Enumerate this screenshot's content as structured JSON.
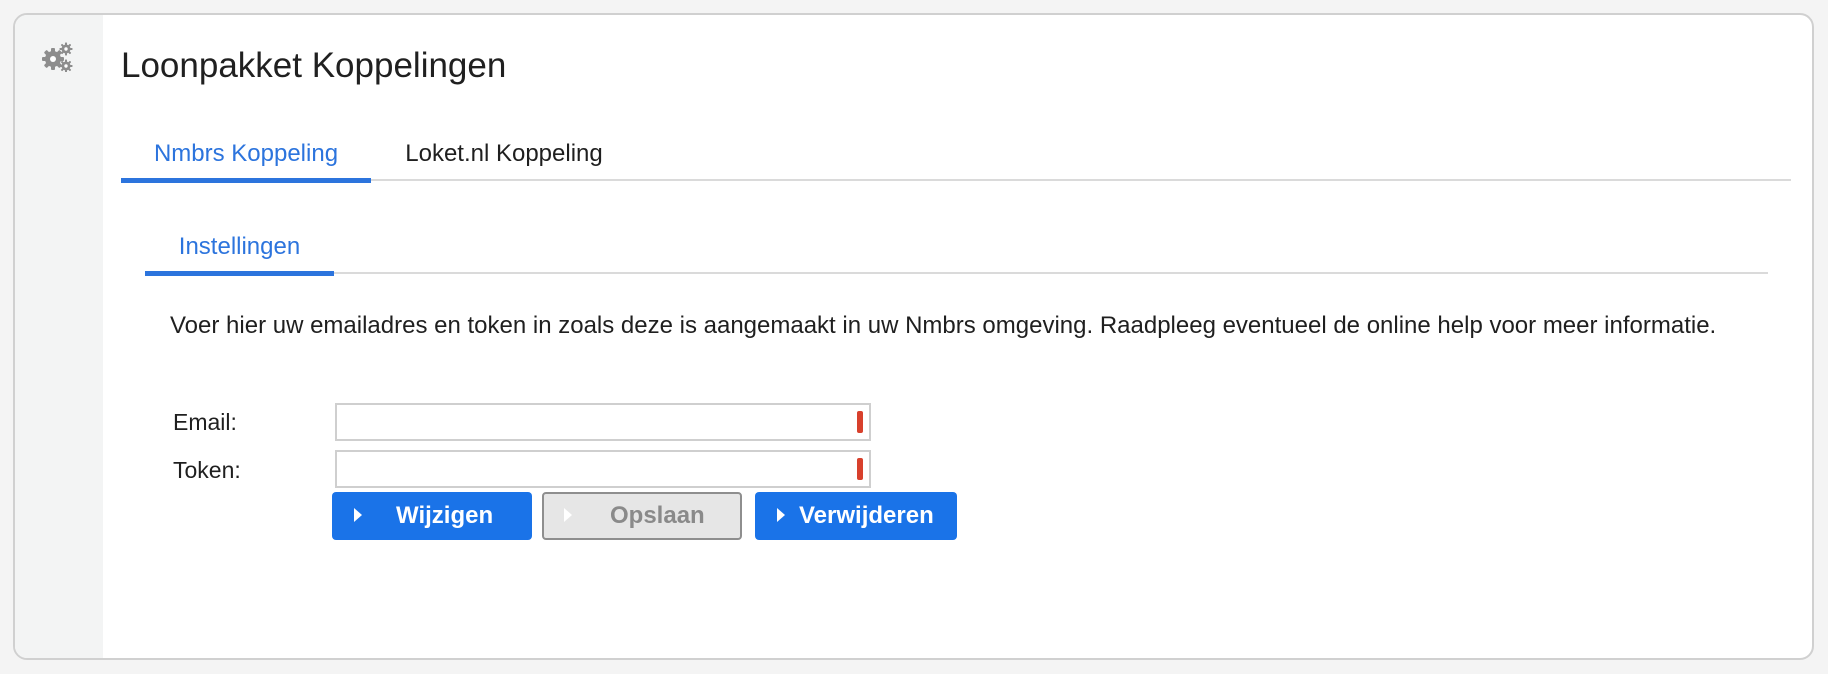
{
  "header": {
    "title": "Loonpakket Koppelingen",
    "icon": "gears-icon",
    "icon_color": "#8d8d8d"
  },
  "main_tabs": [
    {
      "label": "Nmbrs Koppeling",
      "active": true
    },
    {
      "label": "Loket.nl Koppeling",
      "active": false
    }
  ],
  "sub_tabs": [
    {
      "label": "Instellingen",
      "active": true
    }
  ],
  "description": "Voer hier uw emailadres en token in zoals deze is aangemaakt in uw Nmbrs omgeving. Raadpleeg eventueel de online help voor meer informatie.",
  "form": {
    "email": {
      "label": "Email:",
      "value": "",
      "required": true
    },
    "token": {
      "label": "Token:",
      "value": "",
      "required": true
    }
  },
  "buttons": {
    "change": {
      "label": "Wijzigen",
      "enabled": true
    },
    "save": {
      "label": "Opslaan",
      "enabled": false
    },
    "delete": {
      "label": "Verwijderen",
      "enabled": true
    }
  },
  "colors": {
    "accent": "#1a73e8",
    "active_tab": "#2c74dd",
    "required_marker": "#d8402c",
    "disabled_button_bg": "#e6e6e6"
  }
}
